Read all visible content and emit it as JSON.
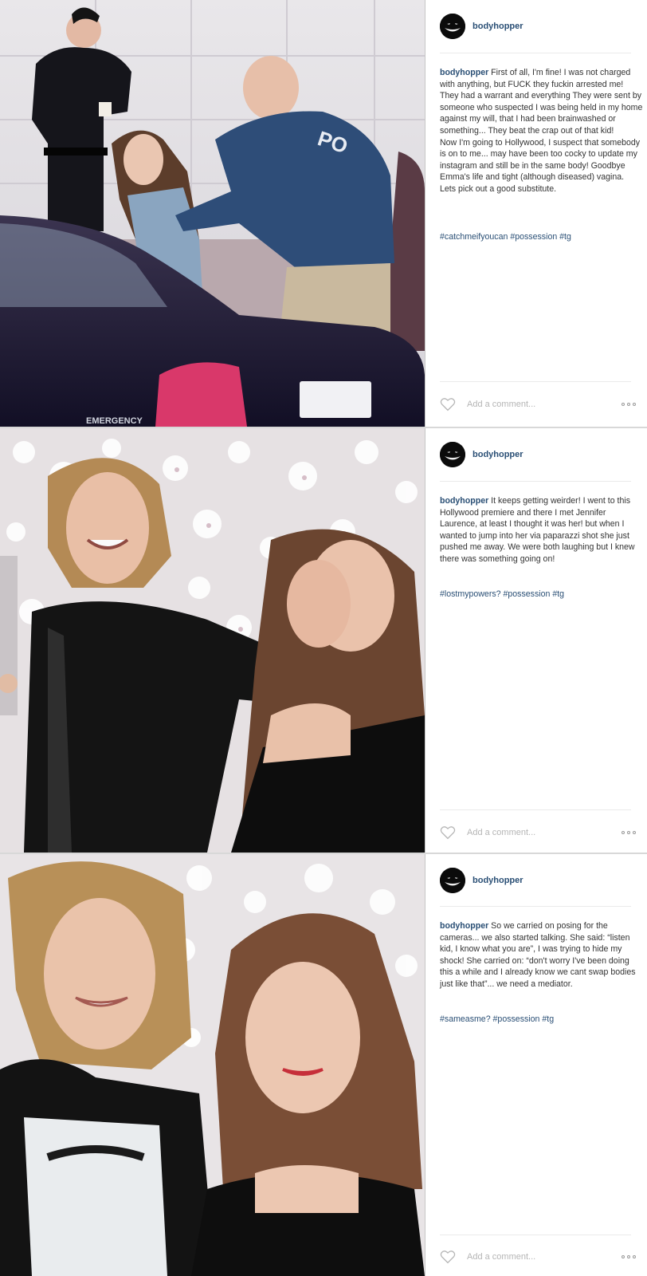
{
  "posts": [
    {
      "username": "bodyhopper",
      "caption_user": "bodyhopper",
      "caption": " First of all, I'm fine! I was not charged with anything, but FUCK they fuckin arrested me! They had a warrant and everything They were sent by someone who suspected I was being held in my home against my will, that I had been brainwashed or something... They beat the crap out of that kid!\nNow I'm going to Hollywood, I suspect that somebody is on to me... may have been too cocky to update my instagram and still be in the same body! Goodbye  Emma's life and tight (although diseased) vagina.\nLets pick out a good substitute.",
      "hashtags": "#catchmeifyoucan #possession #tg",
      "comment_placeholder": "Add a comment...",
      "photo": {
        "icon": "arrest-scene-photo",
        "car_text": "EMERGENCY",
        "jacket_text": "PO"
      }
    },
    {
      "username": "bodyhopper",
      "caption_user": "bodyhopper",
      "caption": " It keeps getting weirder! I went to this Hollywood premiere and there I met Jennifer Laurence, at least I thought it was her! but when I wanted to jump into her via paparazzi shot she just pushed me away. We were both laughing but I knew there was something going on!",
      "hashtags": "#lostmypowers? #possession #tg",
      "comment_placeholder": "Add a comment...",
      "photo": {
        "icon": "premiere-photo"
      }
    },
    {
      "username": "bodyhopper",
      "caption_user": "bodyhopper",
      "caption": " So we carried on posing for the cameras... we also started talking. She said: “listen kid, I know what you are”, I was trying to hide my shock! She carried on: “don't worry I've been doing this a while and I already know we cant swap bodies just like that”... we need a mediator.",
      "hashtags": "#sameasme? #possession #tg",
      "comment_placeholder": "Add a comment...",
      "photo": {
        "icon": "posing-photo"
      }
    }
  ],
  "colors": {
    "username": "#2a4f75",
    "text": "#333333",
    "placeholder": "#b5b5b5",
    "divider": "#c7c7c7"
  }
}
